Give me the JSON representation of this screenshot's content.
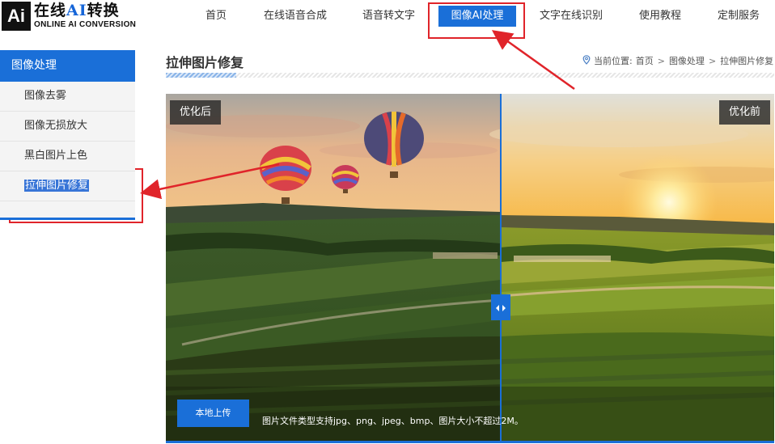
{
  "logo": {
    "mark": "Ai",
    "name_prefix": "在线",
    "name_ai": "AI",
    "name_suffix": "转换",
    "subtitle": "ONLINE AI CONVERSION"
  },
  "nav": {
    "items": [
      {
        "label": "首页"
      },
      {
        "label": "在线语音合成"
      },
      {
        "label": "语音转文字"
      },
      {
        "label": "图像AI处理",
        "active": true
      },
      {
        "label": "文字在线识别"
      },
      {
        "label": "使用教程"
      },
      {
        "label": "定制服务"
      }
    ]
  },
  "sidebar": {
    "title": "图像处理",
    "items": [
      {
        "label": "图像去雾"
      },
      {
        "label": "图像无损放大"
      },
      {
        "label": "黑白图片上色"
      },
      {
        "label": "拉伸图片修复",
        "selected": true
      }
    ]
  },
  "page": {
    "title": "拉伸图片修复"
  },
  "breadcrumb": {
    "prefix": "当前位置:",
    "items": [
      "首页",
      "图像处理",
      "拉伸图片修复"
    ],
    "separator": ">"
  },
  "viewer": {
    "label_after": "优化后",
    "label_before": "优化前",
    "upload_button": "本地上传",
    "upload_hint": "图片文件类型支持jpg、png、jpeg、bmp、图片大小不超过2M。"
  },
  "colors": {
    "accent": "#1a6fd8",
    "annotation": "#e0242a"
  },
  "icons": {
    "location": "location-pin-icon",
    "handle": "left-right-arrows-icon"
  }
}
